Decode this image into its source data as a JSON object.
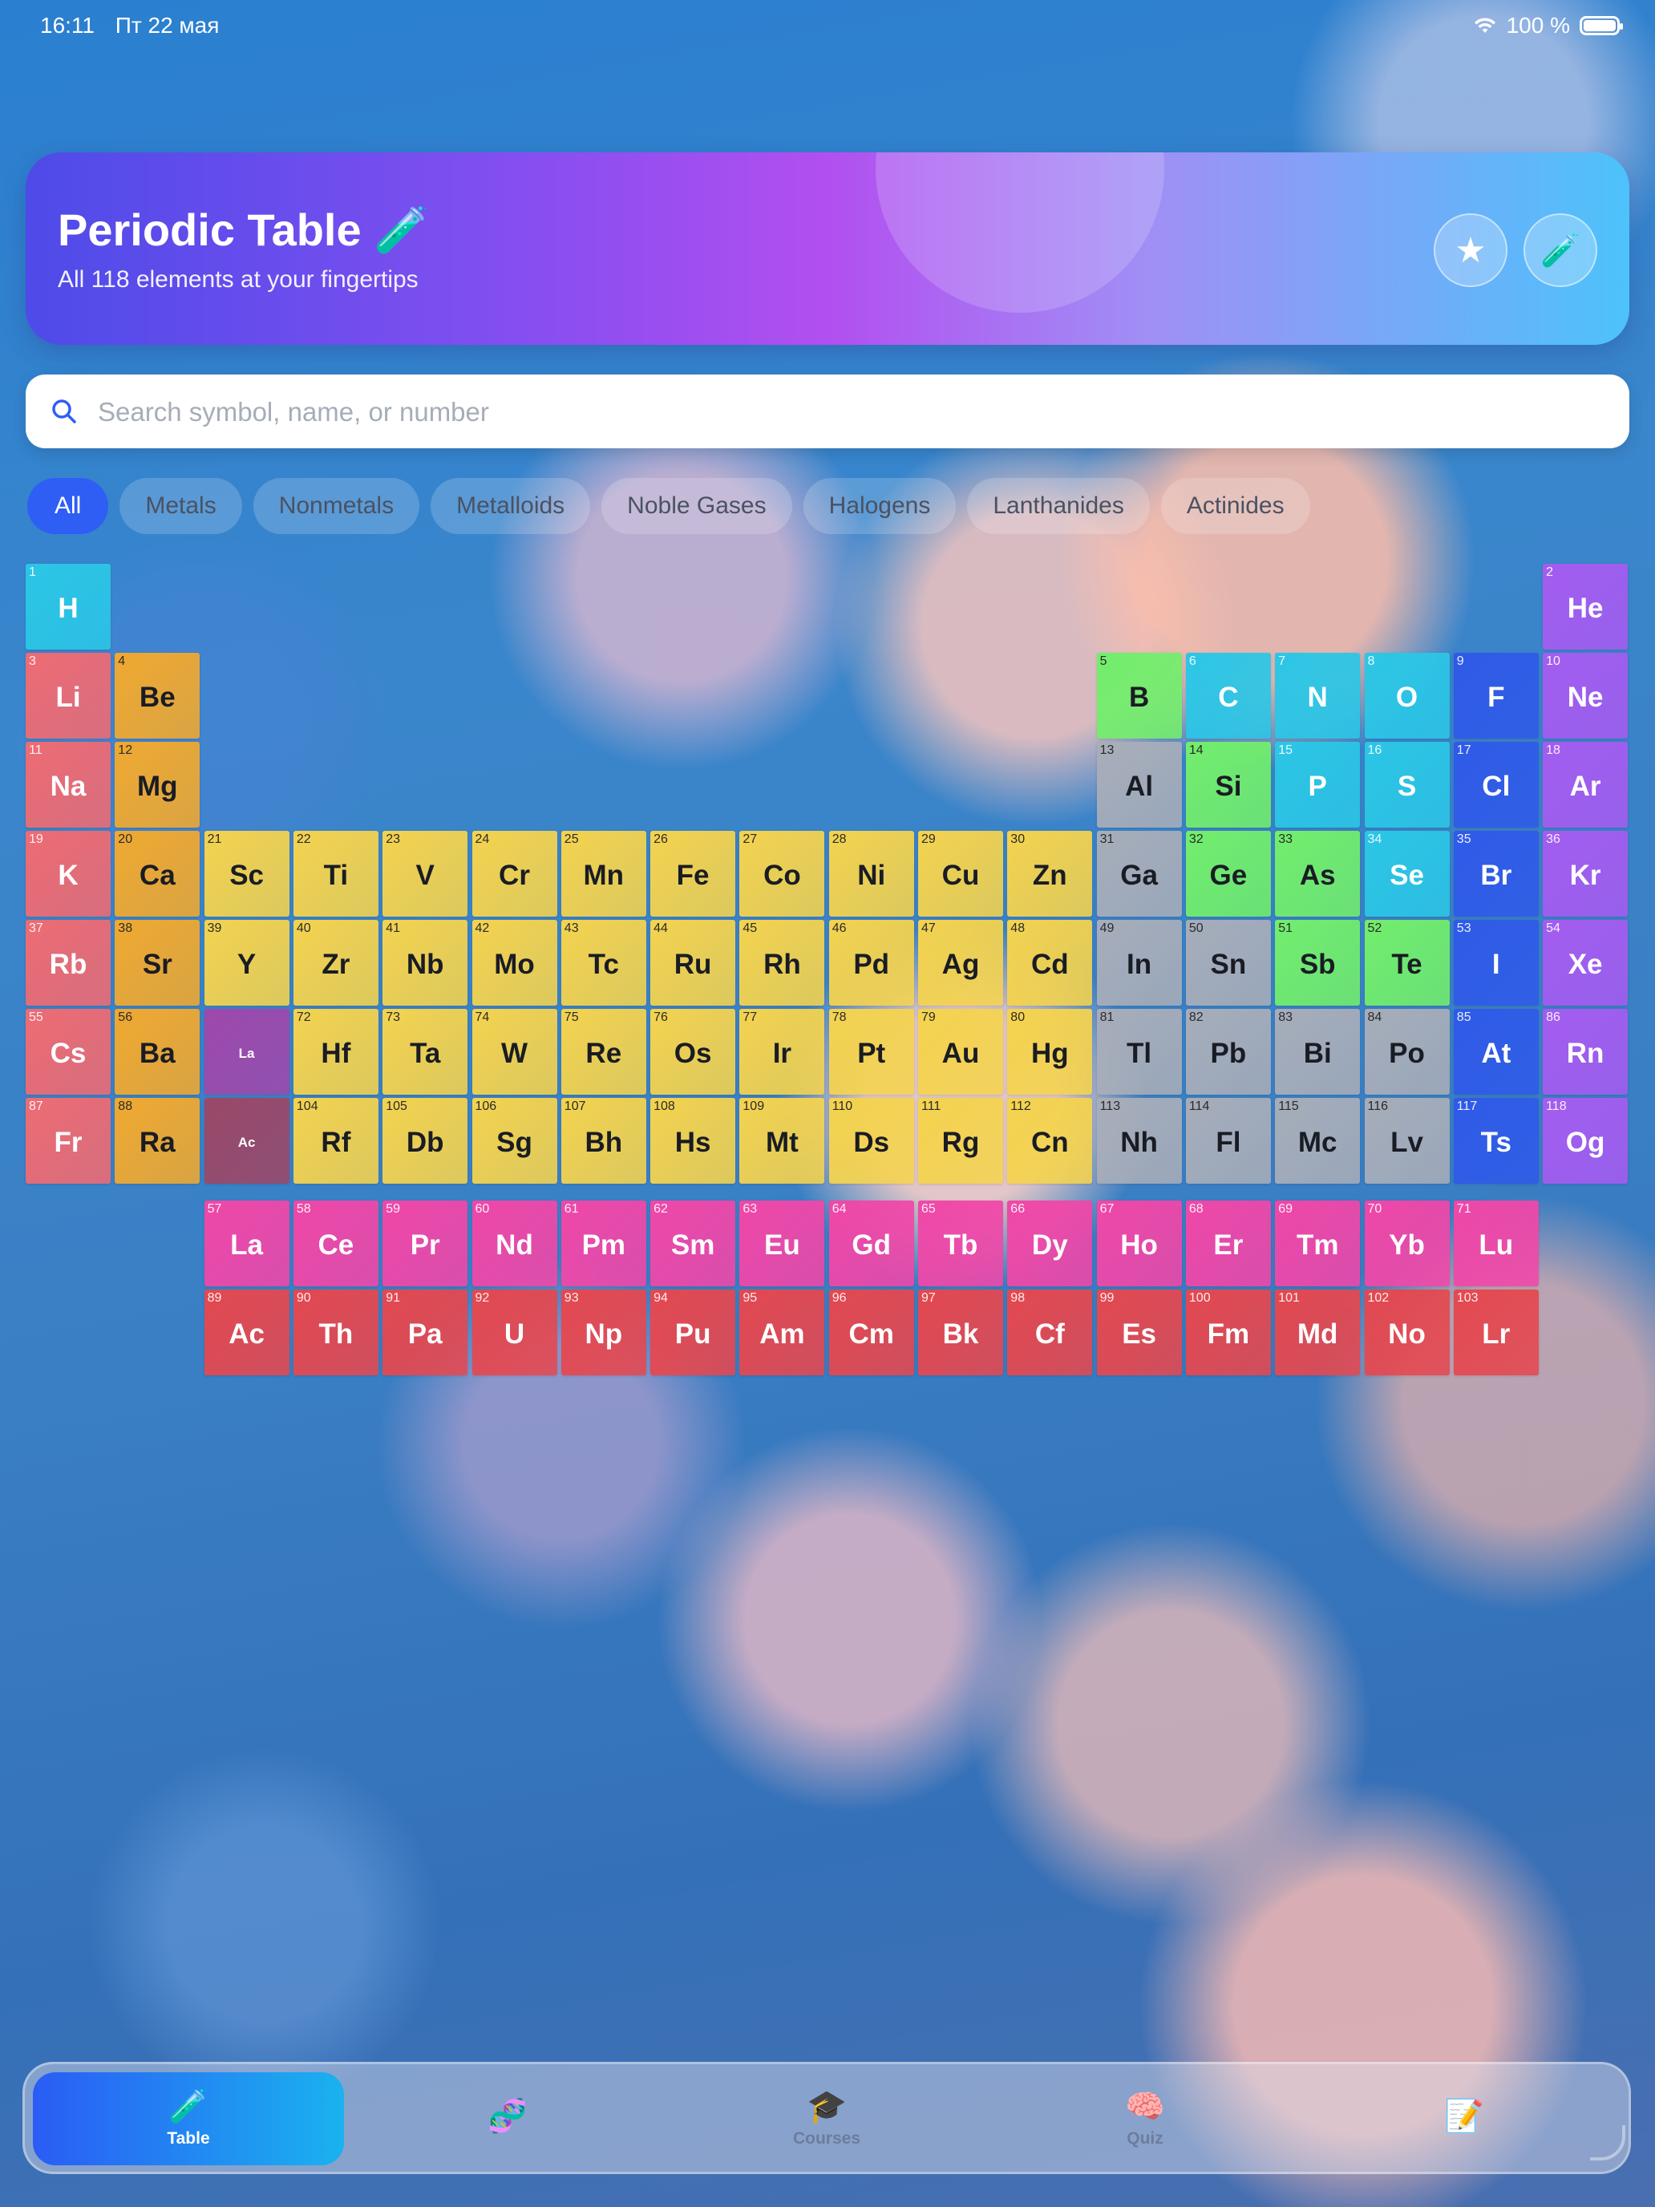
{
  "status_bar": {
    "time": "16:11",
    "date": "Пт 22 мая",
    "battery": "100 %"
  },
  "header": {
    "title": "Periodic Table 🧪",
    "subtitle": "All 118 elements at your fingertips",
    "favorites_icon": "★",
    "lab_icon": "🧪"
  },
  "search": {
    "placeholder": "Search symbol, name, or number",
    "value": ""
  },
  "filters": [
    "All",
    "Metals",
    "Nonmetals",
    "Metalloids",
    "Noble Gases",
    "Halogens",
    "Lanthanides",
    "Actinides"
  ],
  "active_filter": "All",
  "colors": {
    "alkali": "#ee6b73",
    "alkaline": "#f0a930",
    "transition": "#f4d34e",
    "posttransition": "#a7adb9",
    "metalloid": "#72ee6c",
    "nonmetal": "#2bc6e6",
    "halogen": "#2f5ae8",
    "noble": "#a45cf0",
    "lanthanide": "#f047a8",
    "actinide": "#e44850",
    "placeholder_la": "#9d49ac",
    "placeholder_ac": "#9a4868"
  },
  "elements": [
    {
      "n": "1",
      "s": "H",
      "cat": "nonmetal",
      "row": 1,
      "col": 1
    },
    {
      "n": "2",
      "s": "He",
      "cat": "noble",
      "row": 1,
      "col": 18
    },
    {
      "n": "3",
      "s": "Li",
      "cat": "alkali",
      "row": 2,
      "col": 1
    },
    {
      "n": "4",
      "s": "Be",
      "cat": "alkaline",
      "row": 2,
      "col": 2
    },
    {
      "n": "5",
      "s": "B",
      "cat": "metalloid",
      "row": 2,
      "col": 13
    },
    {
      "n": "6",
      "s": "C",
      "cat": "nonmetal",
      "row": 2,
      "col": 14
    },
    {
      "n": "7",
      "s": "N",
      "cat": "nonmetal",
      "row": 2,
      "col": 15
    },
    {
      "n": "8",
      "s": "O",
      "cat": "nonmetal",
      "row": 2,
      "col": 16
    },
    {
      "n": "9",
      "s": "F",
      "cat": "halogen",
      "row": 2,
      "col": 17
    },
    {
      "n": "10",
      "s": "Ne",
      "cat": "noble",
      "row": 2,
      "col": 18
    },
    {
      "n": "11",
      "s": "Na",
      "cat": "alkali",
      "row": 3,
      "col": 1
    },
    {
      "n": "12",
      "s": "Mg",
      "cat": "alkaline",
      "row": 3,
      "col": 2
    },
    {
      "n": "13",
      "s": "Al",
      "cat": "posttransition",
      "row": 3,
      "col": 13
    },
    {
      "n": "14",
      "s": "Si",
      "cat": "metalloid",
      "row": 3,
      "col": 14
    },
    {
      "n": "15",
      "s": "P",
      "cat": "nonmetal",
      "row": 3,
      "col": 15
    },
    {
      "n": "16",
      "s": "S",
      "cat": "nonmetal",
      "row": 3,
      "col": 16
    },
    {
      "n": "17",
      "s": "Cl",
      "cat": "halogen",
      "row": 3,
      "col": 17
    },
    {
      "n": "18",
      "s": "Ar",
      "cat": "noble",
      "row": 3,
      "col": 18
    },
    {
      "n": "19",
      "s": "K",
      "cat": "alkali",
      "row": 4,
      "col": 1
    },
    {
      "n": "20",
      "s": "Ca",
      "cat": "alkaline",
      "row": 4,
      "col": 2
    },
    {
      "n": "21",
      "s": "Sc",
      "cat": "transition",
      "row": 4,
      "col": 3
    },
    {
      "n": "22",
      "s": "Ti",
      "cat": "transition",
      "row": 4,
      "col": 4
    },
    {
      "n": "23",
      "s": "V",
      "cat": "transition",
      "row": 4,
      "col": 5
    },
    {
      "n": "24",
      "s": "Cr",
      "cat": "transition",
      "row": 4,
      "col": 6
    },
    {
      "n": "25",
      "s": "Mn",
      "cat": "transition",
      "row": 4,
      "col": 7
    },
    {
      "n": "26",
      "s": "Fe",
      "cat": "transition",
      "row": 4,
      "col": 8
    },
    {
      "n": "27",
      "s": "Co",
      "cat": "transition",
      "row": 4,
      "col": 9
    },
    {
      "n": "28",
      "s": "Ni",
      "cat": "transition",
      "row": 4,
      "col": 10
    },
    {
      "n": "29",
      "s": "Cu",
      "cat": "transition",
      "row": 4,
      "col": 11
    },
    {
      "n": "30",
      "s": "Zn",
      "cat": "transition",
      "row": 4,
      "col": 12
    },
    {
      "n": "31",
      "s": "Ga",
      "cat": "posttransition",
      "row": 4,
      "col": 13
    },
    {
      "n": "32",
      "s": "Ge",
      "cat": "metalloid",
      "row": 4,
      "col": 14
    },
    {
      "n": "33",
      "s": "As",
      "cat": "metalloid",
      "row": 4,
      "col": 15
    },
    {
      "n": "34",
      "s": "Se",
      "cat": "nonmetal",
      "row": 4,
      "col": 16
    },
    {
      "n": "35",
      "s": "Br",
      "cat": "halogen",
      "row": 4,
      "col": 17
    },
    {
      "n": "36",
      "s": "Kr",
      "cat": "noble",
      "row": 4,
      "col": 18
    },
    {
      "n": "37",
      "s": "Rb",
      "cat": "alkali",
      "row": 5,
      "col": 1
    },
    {
      "n": "38",
      "s": "Sr",
      "cat": "alkaline",
      "row": 5,
      "col": 2
    },
    {
      "n": "39",
      "s": "Y",
      "cat": "transition",
      "row": 5,
      "col": 3
    },
    {
      "n": "40",
      "s": "Zr",
      "cat": "transition",
      "row": 5,
      "col": 4
    },
    {
      "n": "41",
      "s": "Nb",
      "cat": "transition",
      "row": 5,
      "col": 5
    },
    {
      "n": "42",
      "s": "Mo",
      "cat": "transition",
      "row": 5,
      "col": 6
    },
    {
      "n": "43",
      "s": "Tc",
      "cat": "transition",
      "row": 5,
      "col": 7
    },
    {
      "n": "44",
      "s": "Ru",
      "cat": "transition",
      "row": 5,
      "col": 8
    },
    {
      "n": "45",
      "s": "Rh",
      "cat": "transition",
      "row": 5,
      "col": 9
    },
    {
      "n": "46",
      "s": "Pd",
      "cat": "transition",
      "row": 5,
      "col": 10
    },
    {
      "n": "47",
      "s": "Ag",
      "cat": "transition",
      "row": 5,
      "col": 11
    },
    {
      "n": "48",
      "s": "Cd",
      "cat": "transition",
      "row": 5,
      "col": 12
    },
    {
      "n": "49",
      "s": "In",
      "cat": "posttransition",
      "row": 5,
      "col": 13
    },
    {
      "n": "50",
      "s": "Sn",
      "cat": "posttransition",
      "row": 5,
      "col": 14
    },
    {
      "n": "51",
      "s": "Sb",
      "cat": "metalloid",
      "row": 5,
      "col": 15
    },
    {
      "n": "52",
      "s": "Te",
      "cat": "metalloid",
      "row": 5,
      "col": 16
    },
    {
      "n": "53",
      "s": "I",
      "cat": "halogen",
      "row": 5,
      "col": 17
    },
    {
      "n": "54",
      "s": "Xe",
      "cat": "noble",
      "row": 5,
      "col": 18
    },
    {
      "n": "55",
      "s": "Cs",
      "cat": "alkali",
      "row": 6,
      "col": 1
    },
    {
      "n": "56",
      "s": "Ba",
      "cat": "alkaline",
      "row": 6,
      "col": 2
    },
    {
      "n": "",
      "s": "La",
      "cat": "placeholder_la",
      "row": 6,
      "col": 3
    },
    {
      "n": "72",
      "s": "Hf",
      "cat": "transition",
      "row": 6,
      "col": 4
    },
    {
      "n": "73",
      "s": "Ta",
      "cat": "transition",
      "row": 6,
      "col": 5
    },
    {
      "n": "74",
      "s": "W",
      "cat": "transition",
      "row": 6,
      "col": 6
    },
    {
      "n": "75",
      "s": "Re",
      "cat": "transition",
      "row": 6,
      "col": 7
    },
    {
      "n": "76",
      "s": "Os",
      "cat": "transition",
      "row": 6,
      "col": 8
    },
    {
      "n": "77",
      "s": "Ir",
      "cat": "transition",
      "row": 6,
      "col": 9
    },
    {
      "n": "78",
      "s": "Pt",
      "cat": "transition",
      "row": 6,
      "col": 10
    },
    {
      "n": "79",
      "s": "Au",
      "cat": "transition",
      "row": 6,
      "col": 11
    },
    {
      "n": "80",
      "s": "Hg",
      "cat": "transition",
      "row": 6,
      "col": 12
    },
    {
      "n": "81",
      "s": "Tl",
      "cat": "posttransition",
      "row": 6,
      "col": 13
    },
    {
      "n": "82",
      "s": "Pb",
      "cat": "posttransition",
      "row": 6,
      "col": 14
    },
    {
      "n": "83",
      "s": "Bi",
      "cat": "posttransition",
      "row": 6,
      "col": 15
    },
    {
      "n": "84",
      "s": "Po",
      "cat": "posttransition",
      "row": 6,
      "col": 16
    },
    {
      "n": "85",
      "s": "At",
      "cat": "halogen",
      "row": 6,
      "col": 17
    },
    {
      "n": "86",
      "s": "Rn",
      "cat": "noble",
      "row": 6,
      "col": 18
    },
    {
      "n": "87",
      "s": "Fr",
      "cat": "alkali",
      "row": 7,
      "col": 1
    },
    {
      "n": "88",
      "s": "Ra",
      "cat": "alkaline",
      "row": 7,
      "col": 2
    },
    {
      "n": "",
      "s": "Ac",
      "cat": "placeholder_ac",
      "row": 7,
      "col": 3
    },
    {
      "n": "104",
      "s": "Rf",
      "cat": "transition",
      "row": 7,
      "col": 4
    },
    {
      "n": "105",
      "s": "Db",
      "cat": "transition",
      "row": 7,
      "col": 5
    },
    {
      "n": "106",
      "s": "Sg",
      "cat": "transition",
      "row": 7,
      "col": 6
    },
    {
      "n": "107",
      "s": "Bh",
      "cat": "transition",
      "row": 7,
      "col": 7
    },
    {
      "n": "108",
      "s": "Hs",
      "cat": "transition",
      "row": 7,
      "col": 8
    },
    {
      "n": "109",
      "s": "Mt",
      "cat": "transition",
      "row": 7,
      "col": 9
    },
    {
      "n": "110",
      "s": "Ds",
      "cat": "transition",
      "row": 7,
      "col": 10
    },
    {
      "n": "111",
      "s": "Rg",
      "cat": "transition",
      "row": 7,
      "col": 11
    },
    {
      "n": "112",
      "s": "Cn",
      "cat": "transition",
      "row": 7,
      "col": 12
    },
    {
      "n": "113",
      "s": "Nh",
      "cat": "posttransition",
      "row": 7,
      "col": 13
    },
    {
      "n": "114",
      "s": "Fl",
      "cat": "posttransition",
      "row": 7,
      "col": 14
    },
    {
      "n": "115",
      "s": "Mc",
      "cat": "posttransition",
      "row": 7,
      "col": 15
    },
    {
      "n": "116",
      "s": "Lv",
      "cat": "posttransition",
      "row": 7,
      "col": 16
    },
    {
      "n": "117",
      "s": "Ts",
      "cat": "halogen",
      "row": 7,
      "col": 17
    },
    {
      "n": "118",
      "s": "Og",
      "cat": "noble",
      "row": 7,
      "col": 18
    },
    {
      "n": "57",
      "s": "La",
      "cat": "lanthanide",
      "row": 8,
      "col": 3
    },
    {
      "n": "58",
      "s": "Ce",
      "cat": "lanthanide",
      "row": 8,
      "col": 4
    },
    {
      "n": "59",
      "s": "Pr",
      "cat": "lanthanide",
      "row": 8,
      "col": 5
    },
    {
      "n": "60",
      "s": "Nd",
      "cat": "lanthanide",
      "row": 8,
      "col": 6
    },
    {
      "n": "61",
      "s": "Pm",
      "cat": "lanthanide",
      "row": 8,
      "col": 7
    },
    {
      "n": "62",
      "s": "Sm",
      "cat": "lanthanide",
      "row": 8,
      "col": 8
    },
    {
      "n": "63",
      "s": "Eu",
      "cat": "lanthanide",
      "row": 8,
      "col": 9
    },
    {
      "n": "64",
      "s": "Gd",
      "cat": "lanthanide",
      "row": 8,
      "col": 10
    },
    {
      "n": "65",
      "s": "Tb",
      "cat": "lanthanide",
      "row": 8,
      "col": 11
    },
    {
      "n": "66",
      "s": "Dy",
      "cat": "lanthanide",
      "row": 8,
      "col": 12
    },
    {
      "n": "67",
      "s": "Ho",
      "cat": "lanthanide",
      "row": 8,
      "col": 13
    },
    {
      "n": "68",
      "s": "Er",
      "cat": "lanthanide",
      "row": 8,
      "col": 14
    },
    {
      "n": "69",
      "s": "Tm",
      "cat": "lanthanide",
      "row": 8,
      "col": 15
    },
    {
      "n": "70",
      "s": "Yb",
      "cat": "lanthanide",
      "row": 8,
      "col": 16
    },
    {
      "n": "71",
      "s": "Lu",
      "cat": "lanthanide",
      "row": 8,
      "col": 17
    },
    {
      "n": "89",
      "s": "Ac",
      "cat": "actinide",
      "row": 9,
      "col": 3
    },
    {
      "n": "90",
      "s": "Th",
      "cat": "actinide",
      "row": 9,
      "col": 4
    },
    {
      "n": "91",
      "s": "Pa",
      "cat": "actinide",
      "row": 9,
      "col": 5
    },
    {
      "n": "92",
      "s": "U",
      "cat": "actinide",
      "row": 9,
      "col": 6
    },
    {
      "n": "93",
      "s": "Np",
      "cat": "actinide",
      "row": 9,
      "col": 7
    },
    {
      "n": "94",
      "s": "Pu",
      "cat": "actinide",
      "row": 9,
      "col": 8
    },
    {
      "n": "95",
      "s": "Am",
      "cat": "actinide",
      "row": 9,
      "col": 9
    },
    {
      "n": "96",
      "s": "Cm",
      "cat": "actinide",
      "row": 9,
      "col": 10
    },
    {
      "n": "97",
      "s": "Bk",
      "cat": "actinide",
      "row": 9,
      "col": 11
    },
    {
      "n": "98",
      "s": "Cf",
      "cat": "actinide",
      "row": 9,
      "col": 12
    },
    {
      "n": "99",
      "s": "Es",
      "cat": "actinide",
      "row": 9,
      "col": 13
    },
    {
      "n": "100",
      "s": "Fm",
      "cat": "actinide",
      "row": 9,
      "col": 14
    },
    {
      "n": "101",
      "s": "Md",
      "cat": "actinide",
      "row": 9,
      "col": 15
    },
    {
      "n": "102",
      "s": "No",
      "cat": "actinide",
      "row": 9,
      "col": 16
    },
    {
      "n": "103",
      "s": "Lr",
      "cat": "actinide",
      "row": 9,
      "col": 17
    }
  ],
  "tabs": [
    {
      "label": "Table",
      "icon": "🧪",
      "active": true
    },
    {
      "label": "",
      "icon": "🧬",
      "active": false
    },
    {
      "label": "Courses",
      "icon": "🎓",
      "active": false
    },
    {
      "label": "Quiz",
      "icon": "🧠",
      "active": false
    },
    {
      "label": "",
      "icon": "📝",
      "active": false
    }
  ]
}
